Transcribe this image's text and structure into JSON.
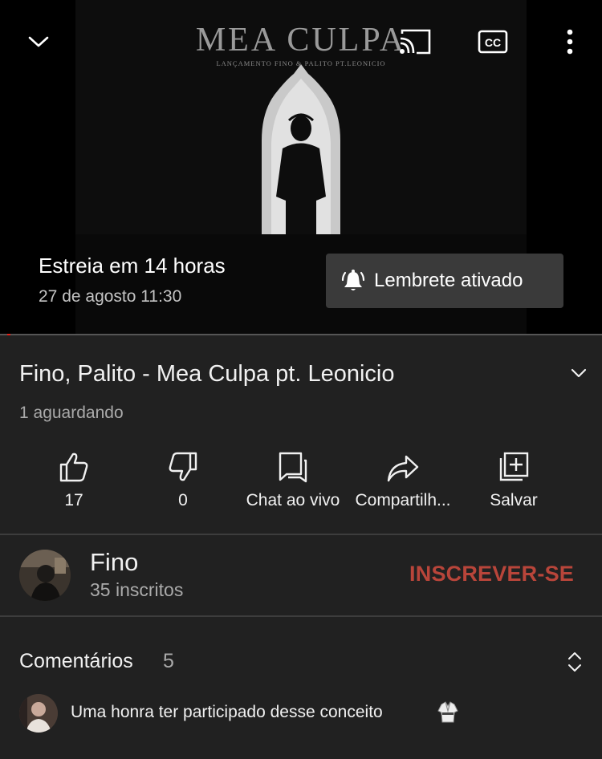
{
  "player": {
    "artwork_title": "MEA CULPA",
    "artwork_subtitle": "LANÇAMENTO FINO & PALITO PT.LEONICIO",
    "premiere_title": "Estreia em 14 horas",
    "premiere_date": "27 de agosto 11:30",
    "reminder_label": "Lembrete ativado",
    "controls": [
      "chevron-down-icon",
      "cast-icon",
      "captions-icon",
      "more-vert-icon"
    ],
    "captions_label": "CC"
  },
  "video": {
    "title": "Fino, Palito - Mea Culpa pt. Leonicio",
    "waiting": "1 aguardando"
  },
  "actions": [
    {
      "icon": "thumb-up-icon",
      "label": "17"
    },
    {
      "icon": "thumb-down-icon",
      "label": "0"
    },
    {
      "icon": "chat-icon",
      "label": "Chat ao vivo"
    },
    {
      "icon": "share-icon",
      "label": "Compartilh..."
    },
    {
      "icon": "save-playlist-icon",
      "label": "Salvar"
    }
  ],
  "channel": {
    "name": "Fino",
    "subscribers": "35 inscritos",
    "subscribe_label": "INSCREVER-SE"
  },
  "comments": {
    "title": "Comentários",
    "count": "5",
    "top_comment": "Uma honra ter participado desse conceito"
  },
  "colors": {
    "background": "#212121",
    "subscribe": "#b8453a",
    "progress": "#e62117"
  }
}
